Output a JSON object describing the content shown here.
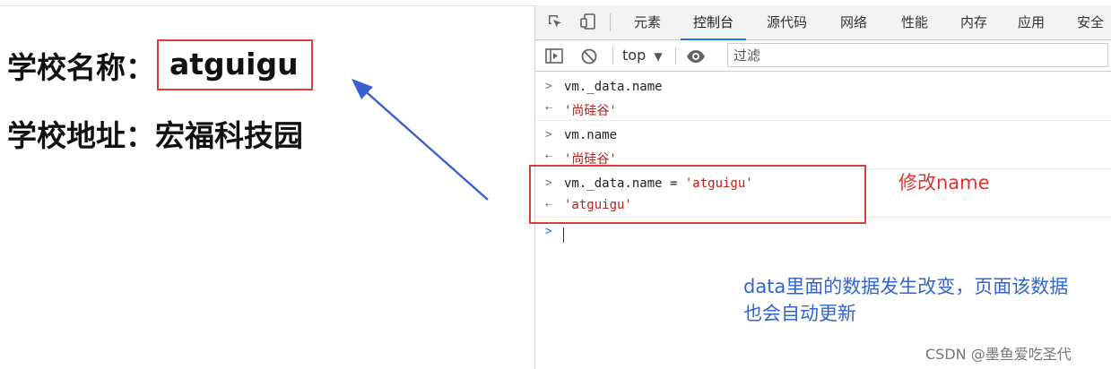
{
  "page": {
    "school_name_label": "学校名称：",
    "school_name_value": "atguigu",
    "school_address_label": "学校地址：",
    "school_address_value": "宏福科技园"
  },
  "devtools": {
    "tabs": [
      "元素",
      "控制台",
      "源代码",
      "网络",
      "性能",
      "内存",
      "应用",
      "安全"
    ],
    "active_tab": "控制台",
    "toolbar": {
      "context": "top",
      "filter_placeholder": "过滤"
    },
    "console": [
      {
        "type": "input",
        "text": "vm._data.name"
      },
      {
        "type": "output",
        "text": "'尚硅谷'"
      },
      {
        "type": "input",
        "text": "vm.name"
      },
      {
        "type": "output",
        "text": "'尚硅谷'"
      },
      {
        "type": "input",
        "text_code": "vm._data.name = ",
        "text_str": "'atguigu'"
      },
      {
        "type": "output",
        "text": "'atguigu'"
      }
    ]
  },
  "annotations": {
    "modify_note": "修改name",
    "explanation_line1": "data里面的数据发生改变，页面该数据",
    "explanation_line2": "也会自动更新"
  },
  "watermark": "CSDN @墨鱼爱吃圣代",
  "colors": {
    "highlight_red": "#d9403b",
    "note_blue": "#3366cc",
    "arrow_blue": "#3a5fd0"
  }
}
